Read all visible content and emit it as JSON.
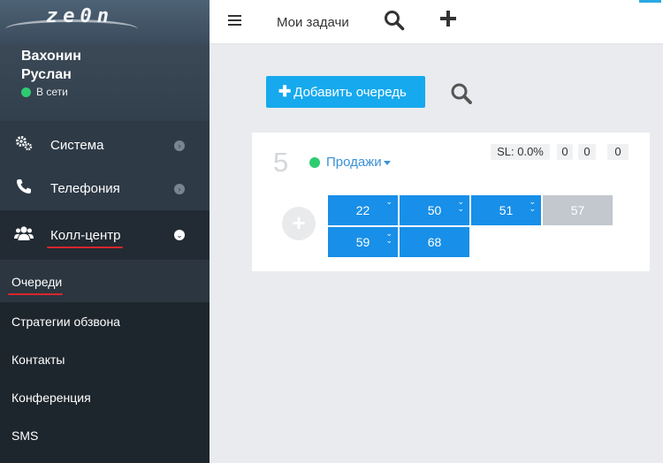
{
  "app": {
    "logo": "ze0n"
  },
  "user": {
    "first_line": "Вахонин",
    "second_line": "Руслан",
    "status": "В сети"
  },
  "sidebar": {
    "items": [
      {
        "label": "Система",
        "icon": "gears-icon"
      },
      {
        "label": "Телефония",
        "icon": "phone-icon"
      },
      {
        "label": "Колл-центр",
        "icon": "users-icon",
        "expanded": true
      }
    ],
    "submenu": [
      {
        "label": "Очереди",
        "active": true
      },
      {
        "label": "Стратегии обзвона"
      },
      {
        "label": "Контакты"
      },
      {
        "label": "Конференция"
      },
      {
        "label": "SMS"
      }
    ]
  },
  "topbar": {
    "title": "Мои задачи",
    "icons": [
      "hamburger-icon",
      "search-icon",
      "plus-icon"
    ]
  },
  "main": {
    "add_queue_label": "Добавить очередь",
    "queue": {
      "number": "5",
      "name": "Продажи",
      "status": "online",
      "sl": "SL: 0.0%",
      "counters": [
        "0",
        "0",
        "0"
      ],
      "agents": [
        {
          "ext": "22",
          "state": "active",
          "marker": "single-chevron"
        },
        {
          "ext": "50",
          "state": "active",
          "marker": "double-chevron"
        },
        {
          "ext": "51",
          "state": "active",
          "marker": "double-chevron"
        },
        {
          "ext": "57",
          "state": "offline",
          "marker": ""
        },
        {
          "ext": "59",
          "state": "active",
          "marker": "double-chevron"
        },
        {
          "ext": "68",
          "state": "active",
          "marker": ""
        }
      ]
    }
  },
  "colors": {
    "accent": "#16a9ee",
    "agent_active": "#188fe8",
    "agent_offline": "#c2c8ce",
    "online": "#2ecc71",
    "sidebar": "#2e3a46",
    "highlight_underline": "#d9262c"
  }
}
